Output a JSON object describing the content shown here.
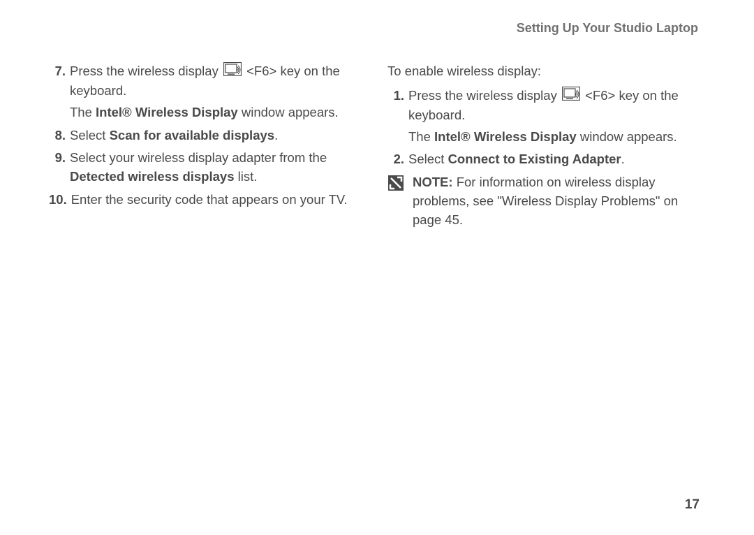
{
  "header": {
    "title": "Setting Up Your Studio Laptop"
  },
  "left": {
    "items": [
      {
        "num": "7.",
        "pre": "Press the wireless display ",
        "post": " <F6> key on the keyboard.",
        "sub_pre": "The ",
        "sub_bold": "Intel® Wireless Display",
        "sub_post": " window appears."
      },
      {
        "num": "8.",
        "pre": "Select ",
        "bold": "Scan for available displays",
        "post": "."
      },
      {
        "num": "9.",
        "pre": "Select your wireless display adapter from the ",
        "bold": "Detected wireless displays",
        "post": " list."
      },
      {
        "num": "10.",
        "text": "Enter the security code that appears on your TV."
      }
    ]
  },
  "right": {
    "intro": "To enable wireless display:",
    "items": [
      {
        "num": "1.",
        "pre": "Press the wireless display ",
        "post": " <F6> key on the keyboard.",
        "sub_pre": "The ",
        "sub_bold": "Intel® Wireless Display",
        "sub_post": " window appears."
      },
      {
        "num": "2.",
        "pre": "Select ",
        "bold": "Connect to Existing Adapter",
        "post": "."
      }
    ],
    "note": {
      "label": "NOTE:",
      "text": " For information on wireless display problems, see \"Wireless Display Problems\" on page 45."
    }
  },
  "page_number": "17"
}
